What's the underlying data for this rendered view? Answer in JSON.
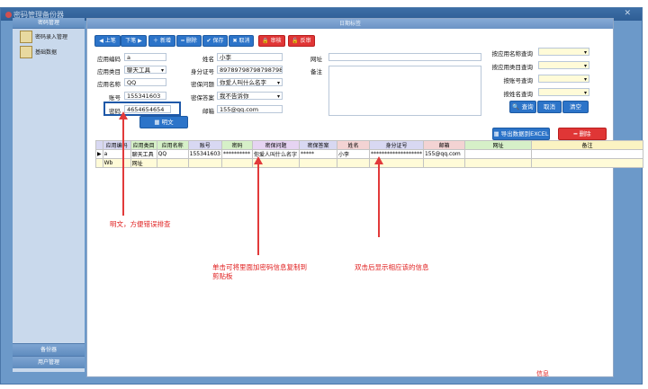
{
  "window": {
    "title": "密码管理备份器",
    "close_glyph": "✕"
  },
  "sidebar": {
    "header": "密码管理",
    "items": [
      {
        "label": "密码录入管理",
        "icon": "notebook-icon"
      },
      {
        "label": "基础数据",
        "icon": "folder-icon"
      }
    ],
    "footer_items": [
      "备份器",
      "用户管理"
    ]
  },
  "main": {
    "title": "日期标签"
  },
  "toolbar": {
    "prev": "◀ 上笔",
    "next": "下笔 ▶",
    "add": "＋ 新增",
    "delete": "━ 删除",
    "save": "✔ 保存",
    "cancel": "✖ 取消",
    "audit": "🔒 审核",
    "unaudit": "🔓 反审"
  },
  "form": {
    "app_code": {
      "label": "应用编码",
      "value": "a"
    },
    "app_category": {
      "label": "应用类目",
      "value": "聊天工具"
    },
    "app_name": {
      "label": "应用名称",
      "value": "QQ"
    },
    "account": {
      "label": "账号",
      "value": "155341603"
    },
    "password": {
      "label": "密码",
      "value": "4654654654"
    },
    "name": {
      "label": "姓名",
      "value": "小李"
    },
    "id_number": {
      "label": "身分证号",
      "value": "897897987987987987"
    },
    "secret_question": {
      "label": "密保问题",
      "value": "你爱人叫什么名字"
    },
    "secret_answer": {
      "label": "密保答案",
      "value": "我不告诉你"
    },
    "email": {
      "label": "邮箱",
      "value": "155@qq.com"
    },
    "url": {
      "label": "网址",
      "value": ""
    },
    "remark": {
      "label": "备注",
      "value": ""
    },
    "plaintext_button": "▦ 明文"
  },
  "search": {
    "by_app_name": "按应用名称查询",
    "by_app_category": "按应用类目查询",
    "by_account": "按账号查询",
    "by_name": "按姓名查询",
    "query_button": "🔍 查询",
    "cancel_button": "取消",
    "clear_button": "清空",
    "export_button": "▦ 导出数据到EXCEL",
    "delete_button": "━ 删除"
  },
  "grid": {
    "columns": [
      "应用编码",
      "应用类目",
      "应用名称",
      "账号",
      "密码",
      "密保问题",
      "密保答案",
      "姓名",
      "身分证号",
      "邮箱",
      "网址",
      "备注"
    ],
    "rows": [
      {
        "marker": "▶",
        "cells": [
          "a",
          "聊天工具",
          "QQ",
          "155341603",
          "**********",
          "你爱人叫什么名字",
          "*****",
          "小李",
          "*******************",
          "155@qq.com",
          "",
          ""
        ]
      },
      {
        "marker": "",
        "cells": [
          "Wb",
          "网址",
          "",
          "",
          "",
          "",
          "",
          "",
          "",
          "",
          "",
          ""
        ]
      }
    ]
  },
  "annotations": {
    "left": "明文，方便错误排查",
    "middle_line1": "单击可将里面加密码信息复制到",
    "middle_line2": "剪贴板",
    "right": "双击后显示相应该的信息"
  },
  "footer": {
    "text": "信息"
  },
  "colors": {
    "accent_blue": "#2c74c9",
    "danger_red": "#e03636",
    "annotation_red": "#e02020",
    "frame_blue": "#6c99c9"
  }
}
